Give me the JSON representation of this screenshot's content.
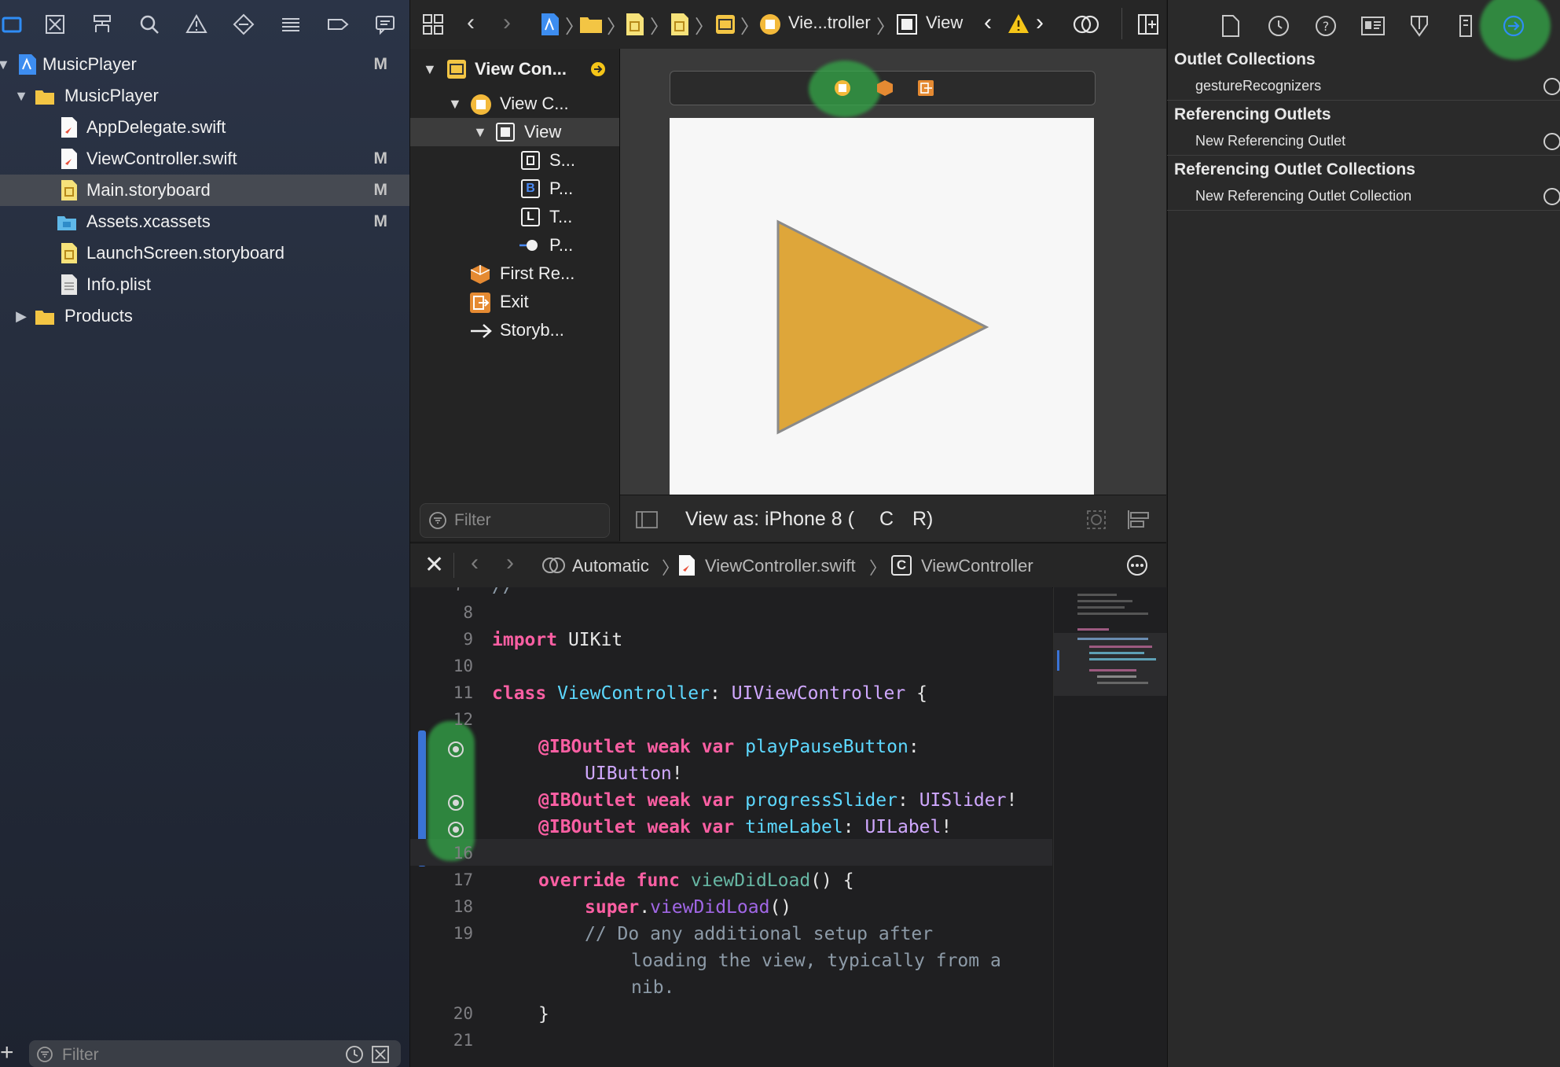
{
  "navigator": {
    "items": [
      {
        "label": "MusicPlayer",
        "badge": "M"
      },
      {
        "label": "MusicPlayer",
        "badge": ""
      },
      {
        "label": "AppDelegate.swift",
        "badge": ""
      },
      {
        "label": "ViewController.swift",
        "badge": "M"
      },
      {
        "label": "Main.storyboard",
        "badge": "M"
      },
      {
        "label": "Assets.xcassets",
        "badge": "M"
      },
      {
        "label": "LaunchScreen.storyboard",
        "badge": ""
      },
      {
        "label": "Info.plist",
        "badge": ""
      },
      {
        "label": "Products",
        "badge": ""
      }
    ],
    "filter_placeholder": "Filter"
  },
  "jump_bar": {
    "controller_label": "Vie...troller",
    "view_label": "View"
  },
  "outline": {
    "items": [
      {
        "label": "View Con..."
      },
      {
        "label": "View C..."
      },
      {
        "label": "View"
      },
      {
        "label": "S...",
        "icon": "slider-icon"
      },
      {
        "label": "P...",
        "icon": "button-icon",
        "glyph": "B"
      },
      {
        "label": "T...",
        "icon": "label-icon",
        "glyph": "L"
      },
      {
        "label": "P...",
        "icon": "gesture-icon"
      },
      {
        "label": "First Re..."
      },
      {
        "label": "Exit"
      },
      {
        "label": "Storyb..."
      }
    ],
    "filter_placeholder": "Filter"
  },
  "canvas": {
    "view_as": "View as: iPhone 8 (",
    "size_class_c": "C",
    "size_class_r": "R)",
    "play_color": "#dea63a"
  },
  "assistant": {
    "mode": "Automatic",
    "file": "ViewController.swift",
    "class_label": "ViewController"
  },
  "code_lines": [
    {
      "n": "8"
    },
    {
      "n": "9"
    },
    {
      "n": "10"
    },
    {
      "n": "11"
    },
    {
      "n": "12"
    },
    {
      "n": ""
    },
    {
      "n": ""
    },
    {
      "n": ""
    },
    {
      "n": "16"
    },
    {
      "n": "17"
    },
    {
      "n": "18"
    },
    {
      "n": "19"
    },
    {
      "n": ""
    },
    {
      "n": ""
    },
    {
      "n": "20"
    },
    {
      "n": "21"
    }
  ],
  "inspector": {
    "sections": [
      {
        "title": "Outlet Collections",
        "item": "gestureRecognizers"
      },
      {
        "title": "Referencing Outlets",
        "item": "New Referencing Outlet"
      },
      {
        "title": "Referencing Outlet Collections",
        "item": "New Referencing Outlet Collection"
      }
    ]
  },
  "colors": {
    "highlight_glow": "#34a848",
    "accent_blue": "#2f8df5",
    "warning_yellow": "#f5c518"
  }
}
